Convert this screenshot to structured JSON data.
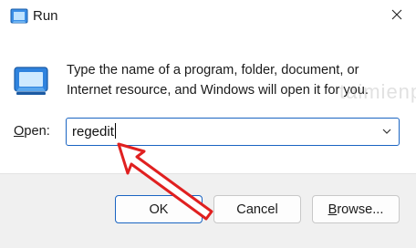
{
  "window": {
    "title": "Run",
    "close_icon": "close-icon",
    "app_icon": "run-icon"
  },
  "body": {
    "description": "Type the name of a program, folder, document, or Internet resource, and Windows will open it for you.",
    "open_label_accel": "O",
    "open_label_rest": "pen:",
    "combo_value": "regedit"
  },
  "buttons": {
    "ok": "OK",
    "cancel": "Cancel",
    "browse_accel": "B",
    "browse_rest": "rowse..."
  },
  "annotation": {
    "arrow_color": "#e02020"
  },
  "colors": {
    "accent": "#1a64c2",
    "footer_bg": "#f0f0f0"
  }
}
